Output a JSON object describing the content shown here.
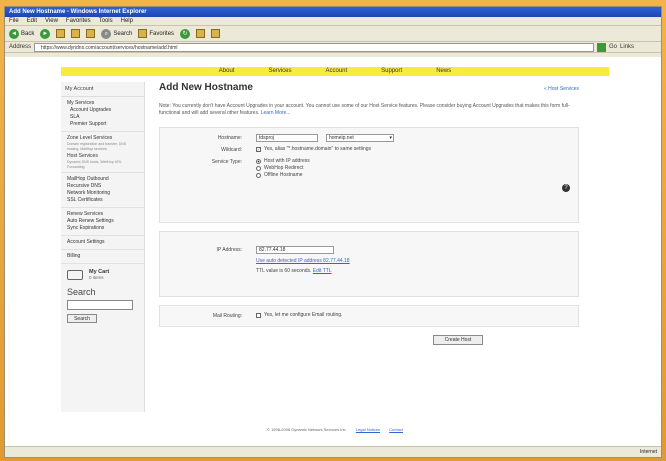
{
  "window": {
    "title": "Add New Hostname - Windows Internet Explorer"
  },
  "menu": [
    "File",
    "Edit",
    "View",
    "Favorites",
    "Tools",
    "Help"
  ],
  "toolbar": {
    "back": "Back",
    "search": "Search",
    "favorites": "Favorites"
  },
  "address": {
    "label": "Address",
    "url": "https://www.dyndns.com/account/services/hostname/add.html",
    "go": "Go",
    "links": "Links"
  },
  "nav": [
    "About",
    "Services",
    "Account",
    "Support",
    "News"
  ],
  "sidebar": {
    "my_account": "My Account",
    "my_services": "My Services",
    "items1": [
      "Account Upgrades",
      "SLA",
      "Premier Support"
    ],
    "zone": {
      "title": "Zone Level Services",
      "sub": "Domain registration and transfer, DNS hosting, MailHop services"
    },
    "host": {
      "title": "Host Services",
      "sub": "Dynamic DNS hosts, WebHop URL Forwarding"
    },
    "items2": [
      "MailHop Outbound",
      "Recursive DNS",
      "Network Monitoring",
      "SSL Certificates"
    ],
    "items3": [
      "Renew Services",
      "Auto Renew Settings",
      "Sync Expirations"
    ],
    "account_settings": "Account Settings",
    "billing": "Billing",
    "cart": {
      "title": "My Cart",
      "sub": "0 items"
    },
    "search": {
      "title": "Search",
      "button": "Search"
    }
  },
  "main": {
    "title": "Add New Hostname",
    "host_services_link": "« Host Services",
    "note": "Note: You currently don't have Account Upgrades in your account. You cannot use some of our Host Service features. Please consider buying Account Upgrades that makes this form full-functional and will add several other features.",
    "learn_more": "Learn More..."
  },
  "form": {
    "hostname_label": "Hostname:",
    "hostname_value": "tdsproj",
    "domain_value": "homeip.net",
    "wildcard_label": "Wildcard:",
    "wildcard_text": "Yes, alias \"*.hostname.domain\" to same settings",
    "service_type_label": "Service Type:",
    "service_types": [
      "Host with IP address",
      "WebHop Redirect",
      "Offline Hostname"
    ],
    "ip_label": "IP Address:",
    "ip_value": "82.77.44.18",
    "ip_detected_link": "Use auto detected IP address 82.77.44.18",
    "ttl_text": "TTL value is 60 seconds.",
    "ttl_link": "Edit TTL",
    "mail_label": "Mail Routing:",
    "mail_text": "Yes, let me configure Email routing.",
    "create_button": "Create Host"
  },
  "footer": {
    "copyright": "© 1998-2008 Dynamic Network Services Inc.",
    "legal": "Legal Notices",
    "contact": "Contact"
  },
  "status": {
    "zone": "Internet"
  }
}
